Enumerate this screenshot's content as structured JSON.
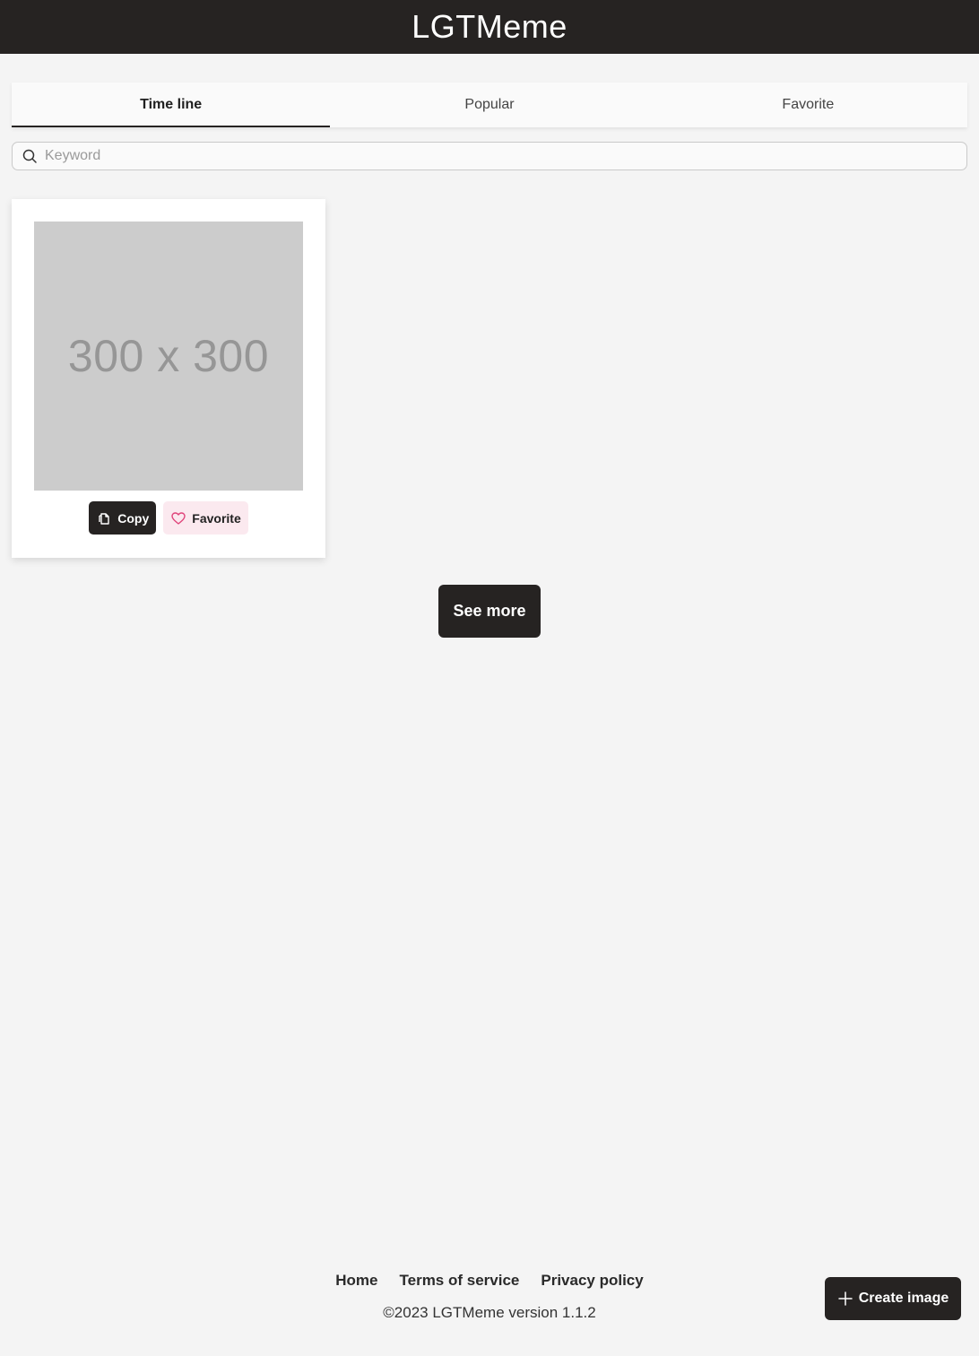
{
  "header": {
    "title": "LGTMeme"
  },
  "tabs": [
    {
      "label": "Time line",
      "active": true
    },
    {
      "label": "Popular",
      "active": false
    },
    {
      "label": "Favorite",
      "active": false
    }
  ],
  "search": {
    "placeholder": "Keyword",
    "value": ""
  },
  "cards": [
    {
      "image_text": "300 x 300",
      "copy_label": "Copy",
      "favorite_label": "Favorite"
    }
  ],
  "see_more_label": "See more",
  "footer": {
    "links": [
      "Home",
      "Terms of service",
      "Privacy policy"
    ],
    "copyright": "©2023 LGTMeme version 1.1.2"
  },
  "create_button_label": "Create image",
  "icons": {
    "search": "search-icon",
    "copy": "copy-icon",
    "favorite": "heart-icon",
    "create": "plus-icon"
  },
  "colors": {
    "header_bg": "#262322",
    "page_bg": "#f4f4f4",
    "button_dark": "#262322",
    "favorite_bg": "#fbe9ef",
    "heart_accent": "#e0457b"
  }
}
